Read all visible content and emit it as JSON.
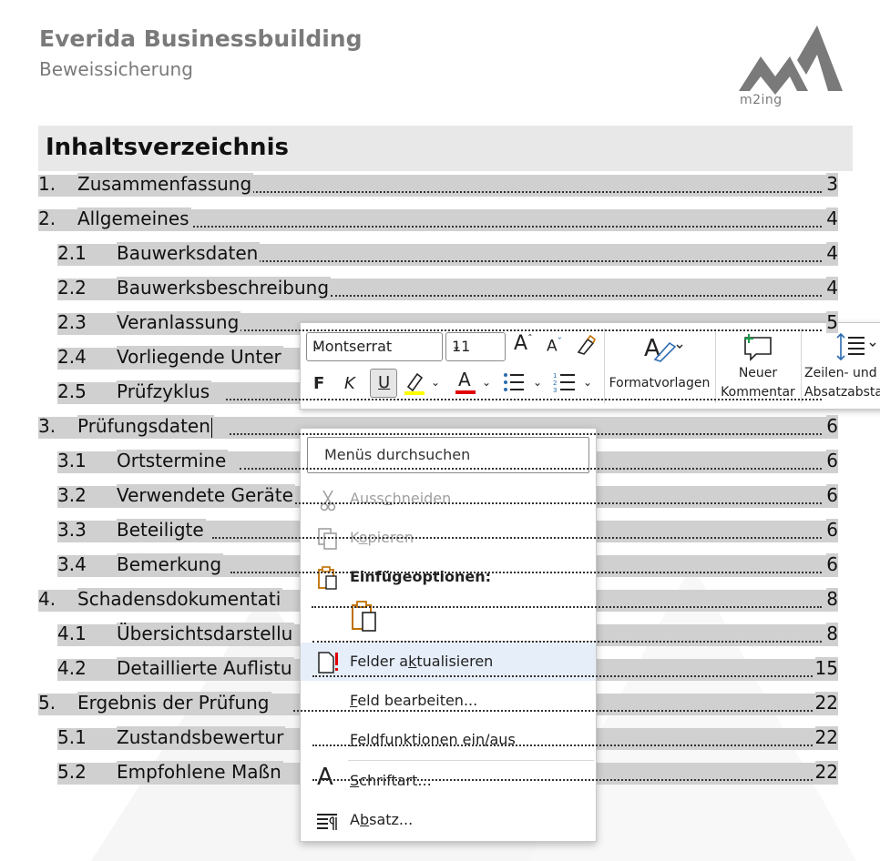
{
  "header": {
    "title": "Everida Businessbuilding",
    "subtitle": "Beweissicherung",
    "logo_text": "m2ing"
  },
  "toc": {
    "heading": "Inhaltsverzeichnis",
    "entries": [
      {
        "num": "1.",
        "text": "Zusammenfassung",
        "page": "3"
      },
      {
        "num": "2.",
        "text": "Allgemeines",
        "page": "4"
      },
      {
        "num": "2.1",
        "text": "Bauwerksdaten",
        "page": "4"
      },
      {
        "num": "2.2",
        "text": "Bauwerksbeschreibung",
        "page": "4"
      },
      {
        "num": "2.3",
        "text": "Veranlassung",
        "page": "5"
      },
      {
        "num": "2.4",
        "text": "Vorliegende Unter",
        "page": ""
      },
      {
        "num": "2.5",
        "text": "Prüfzyklus",
        "page": ""
      },
      {
        "num": "3.",
        "text": "Prüfungsdaten",
        "page": "6"
      },
      {
        "num": "3.1",
        "text": "Ortstermine",
        "page": "6"
      },
      {
        "num": "3.2",
        "text": "Verwendete Geräte",
        "page": "6"
      },
      {
        "num": "3.3",
        "text": "Beteiligte",
        "page": "6"
      },
      {
        "num": "3.4",
        "text": "Bemerkung",
        "page": "6"
      },
      {
        "num": "4.",
        "text": "Schadensdokumentati",
        "page": "8"
      },
      {
        "num": "4.1",
        "text": "Übersichtsdarstellu",
        "page": "8"
      },
      {
        "num": "4.2",
        "text": "Detaillierte Auflistu",
        "page": "15"
      },
      {
        "num": "5.",
        "text": "Ergebnis der Prüfung",
        "page": "22"
      },
      {
        "num": "5.1",
        "text": "Zustandsbewertur",
        "page": "22"
      },
      {
        "num": "5.2",
        "text": "Empfohlene Maßn",
        "page": "22"
      }
    ]
  },
  "mini_toolbar": {
    "font_name": "Montserrat",
    "font_size": "11",
    "bold_label": "F",
    "italic_label": "K",
    "underline_label": "U",
    "styles_label": "Formatvorlagen",
    "comment_label_1": "Neuer",
    "comment_label_2": "Kommentar",
    "spacing_label_1": "Zeilen- und",
    "spacing_label_2": "Absatzabsta",
    "highlight_color": "#ffff00",
    "font_color": "#e00000"
  },
  "context_menu": {
    "search_placeholder": "Menüs durchsuchen",
    "cut": {
      "pre": "Auss",
      "u": "c",
      "post": "hneiden"
    },
    "copy": {
      "pre": "K",
      "u": "o",
      "post": "pieren"
    },
    "paste_options": "Einfügeoptionen:",
    "update_field": {
      "pre": "Felder a",
      "u": "k",
      "post": "tualisieren"
    },
    "edit_field": {
      "pre": "",
      "u": "F",
      "post": "eld bearbeiten..."
    },
    "toggle_codes": {
      "pre": "",
      "u": "F",
      "post": "eldfunktionen ein/aus"
    },
    "font": {
      "pre": "",
      "u": "S",
      "post": "chriftart..."
    },
    "paragraph": {
      "pre": "A",
      "u": "b",
      "post": "satz..."
    }
  }
}
